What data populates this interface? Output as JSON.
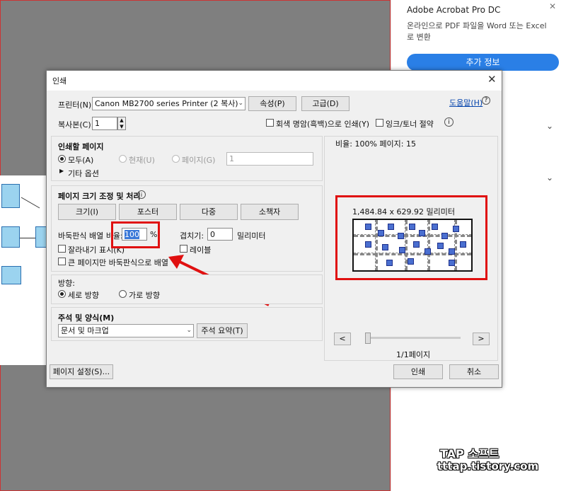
{
  "right_panel": {
    "title": "Adobe Acrobat Pro DC",
    "description": "온라인으로 PDF 파일을 Word 또는 Excel 로 변환",
    "more_info": "추가 정보",
    "close": "✕"
  },
  "dialog": {
    "title": "인쇄",
    "close": "✕",
    "printer_label": "프린터(N):",
    "printer_value": "Canon MB2700 series Printer (2 복사)",
    "properties_btn": "속성(P)",
    "advanced_btn": "고급(D)",
    "help_link": "도움말(H)",
    "copies_label": "복사본(C):",
    "copies_value": "1",
    "grayscale_label": "회색 명암(흑백)으로 인쇄(Y)",
    "save_ink_label": "잉크/토너 절약",
    "pages_section": {
      "title": "인쇄할 페이지",
      "all": "모두(A)",
      "current": "현재(U)",
      "pages": "페이지(G)",
      "pages_value": "1",
      "more_options": "기타 옵션"
    },
    "sizing_section": {
      "title": "페이지 크기 조정 및 처리",
      "size_btn": "크기(I)",
      "poster_btn": "포스터",
      "multiple_btn": "다중",
      "booklet_btn": "소책자",
      "tile_scale_label": "바둑판식 배열 비율:",
      "tile_scale_value": "100",
      "percent": "%",
      "overlap_label": "겹치기:",
      "overlap_value": "0",
      "overlap_unit": "밀리미터",
      "cut_marks": "잘라내기 표시(K)",
      "labels": "레이블",
      "tile_large_only": "큰 페이지만 바둑판식으로 배열"
    },
    "orientation_section": {
      "title": "방향:",
      "portrait": "세로 방향",
      "landscape": "가로 방향"
    },
    "comments_section": {
      "title": "주석 및 양식(M)",
      "value": "문서 및 마크업",
      "summarize_btn": "주석 요약(T)"
    },
    "page_setup_btn": "페이지 설정(S)...",
    "print_btn": "인쇄",
    "cancel_btn": "취소",
    "preview": {
      "scale_text": "비율: 100% 페이지: 15",
      "dimensions": "1,484.84 x 629.92 밀리미터",
      "page_count": "1/1페이지",
      "prev": "<",
      "next": ">"
    }
  },
  "watermark": {
    "line1": "TAP 소프트",
    "line2": "tttap.tistory.com"
  },
  "colors": {
    "accent": "#2a7fe6",
    "highlight": "#e01010"
  }
}
